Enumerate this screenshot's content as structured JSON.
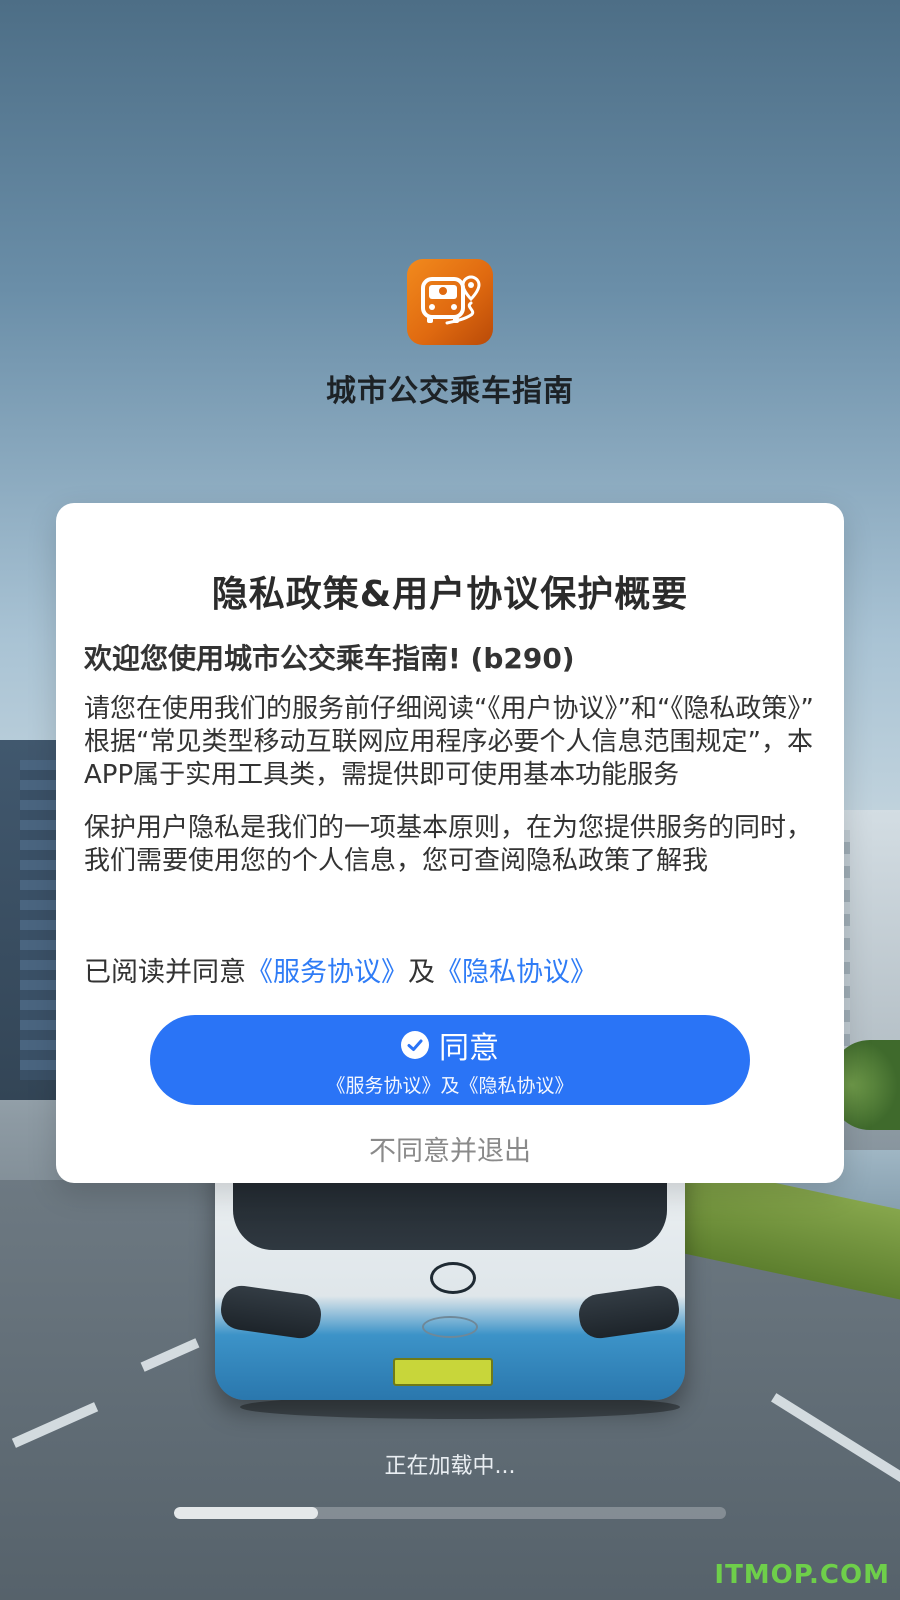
{
  "app": {
    "name": "城市公交乘车指南",
    "logo_icon": "bus-location-icon",
    "accent_color": "#2a74f6"
  },
  "dialog": {
    "title": "隐私政策&用户协议保护概要",
    "welcome": "欢迎您使用城市公交乘车指南! (b290)",
    "paragraphs": [
      "请您在使用我们的服务前仔细阅读“《用户协议》”和“《隐私政策》”",
      "根据“常见类型移动互联网应用程序必要个人信息范围规定”，本APP属于实用工具类，需提供即可使用基本功能服务",
      "保护用户隐私是我们的一项基本原则，在为您提供服务的同时，我们需要使用您的个人信息，您可查阅隐私政策了解我"
    ],
    "agree_line": {
      "prefix": "已阅读并同意",
      "service_link": "《服务协议》",
      "conjunction": "及",
      "privacy_link": "《隐私协议》"
    },
    "agree_button": {
      "label": "同意",
      "sub_label": "《服务协议》及《隐私协议》",
      "icon": "check-circle-icon"
    },
    "decline_label": "不同意并退出"
  },
  "loading": {
    "text": "正在加载中...",
    "progress": 0.26
  },
  "watermark": "ITMOP.COM"
}
